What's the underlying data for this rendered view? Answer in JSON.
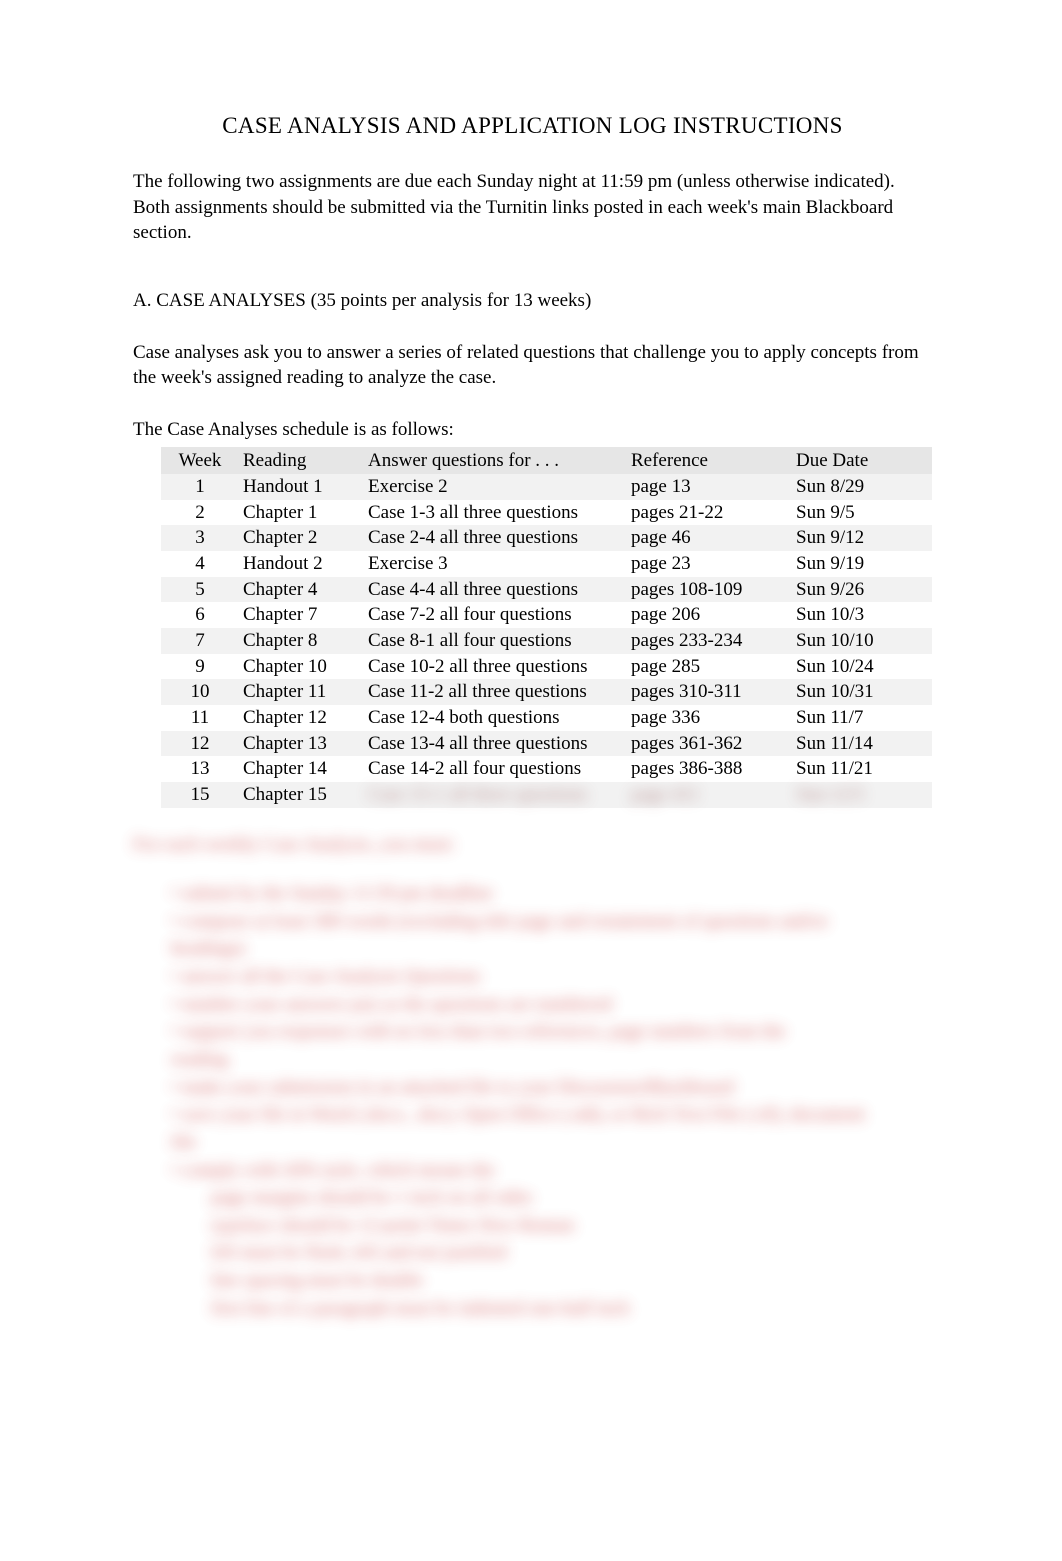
{
  "title": "CASE ANALYSIS AND APPLICATION LOG INSTRUCTIONS",
  "intro": "The following two assignments are due each Sunday night at 11:59 pm (unless otherwise indicated). Both assignments should be submitted via the Turnitin links posted in each week's main Blackboard section.",
  "section_a_heading": "A. CASE ANALYSES (35 points per analysis for 13 weeks)",
  "case_desc": "Case analyses ask you to answer a series of related questions that challenge you to apply concepts from the week's assigned reading to analyze the case.",
  "sched_intro": "The Case Analyses schedule is as follows:",
  "table": {
    "headers": {
      "week": "Week",
      "reading": "Reading",
      "answer": "Answer questions for . . .",
      "reference": "Reference",
      "due": "Due Date"
    },
    "rows": [
      {
        "week": "1",
        "reading": "Handout 1",
        "answer": "Exercise 2",
        "reference": "page 13",
        "due": "Sun 8/29"
      },
      {
        "week": "2",
        "reading": "Chapter 1",
        "answer": "Case 1-3 all three questions",
        "reference": "pages 21-22",
        "due": "Sun 9/5"
      },
      {
        "week": "3",
        "reading": "Chapter 2",
        "answer": "Case 2-4 all three questions",
        "reference": "page 46",
        "due": "Sun 9/12"
      },
      {
        "week": "4",
        "reading": "Handout 2",
        "answer": "Exercise 3",
        "reference": "page 23",
        "due": "Sun 9/19"
      },
      {
        "week": "5",
        "reading": "Chapter 4",
        "answer": "Case 4-4 all three questions",
        "reference": "pages 108-109",
        "due": "Sun 9/26"
      },
      {
        "week": "6",
        "reading": "Chapter 7",
        "answer": "Case 7-2 all four questions",
        "reference": "page 206",
        "due": "Sun 10/3"
      },
      {
        "week": "7",
        "reading": "Chapter 8",
        "answer": "Case 8-1 all four questions",
        "reference": "pages 233-234",
        "due": "Sun 10/10"
      },
      {
        "week": "9",
        "reading": "Chapter 10",
        "answer": "Case 10-2 all three questions",
        "reference": "page 285",
        "due": "Sun 10/24"
      },
      {
        "week": "10",
        "reading": "Chapter 11",
        "answer": "Case 11-2 all three questions",
        "reference": "pages 310-311",
        "due": "Sun 10/31"
      },
      {
        "week": "11",
        "reading": "Chapter 12",
        "answer": "Case 12-4 both questions",
        "reference": "page 336",
        "due": "Sun 11/7"
      },
      {
        "week": "12",
        "reading": "Chapter 13",
        "answer": "Case 13-4 all three questions",
        "reference": "pages 361-362",
        "due": "Sun 11/14"
      },
      {
        "week": "13",
        "reading": "Chapter 14",
        "answer": "Case 14-2 all four questions",
        "reference": "pages 386-388",
        "due": "Sun 11/21"
      },
      {
        "week": "15",
        "reading": "Chapter 15",
        "answer": "",
        "reference": "",
        "due": ""
      }
    ]
  },
  "blurred": {
    "heading": "For each weekly Case Analysis, you must:",
    "lines": [
      "• submit by the Sunday 11:59 pm deadline",
      "• compose at least 300 words (excluding title page and restatement of questions and/or",
      "  headings)",
      "• answer all the Case Analysis Questions",
      "• number your answers just as the questions are numbered",
      "• support you responses with no less than two references, page numbers from the",
      "  reading",
      "• make your submission in an attached file to your Discussion/Blackboard",
      "• save your file in Word (.docx, .doc), Open Office (.odt), or Rich Text File (.rtf), document",
      "  file",
      "• comply with APA style, which means the",
      "    page margins should be 1 inch on all sides",
      "    typeface should be 12-point Times New Roman",
      "    left must be flush, left and not justified",
      "    line spacing must be double",
      "    first line of a paragraph must be indented one-half inch"
    ],
    "last_row": {
      "answer": "Case 15-1 all three questions",
      "reference": "page 411",
      "due": "Sun 12/5"
    }
  }
}
